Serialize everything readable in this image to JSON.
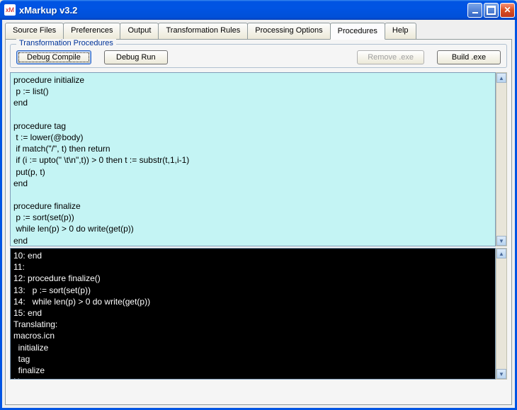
{
  "window": {
    "title": "xMarkup v3.2",
    "app_icon_text": "xM"
  },
  "tabs": [
    {
      "label": "Source Files",
      "active": false
    },
    {
      "label": "Preferences",
      "active": false
    },
    {
      "label": "Output",
      "active": false
    },
    {
      "label": "Transformation Rules",
      "active": false
    },
    {
      "label": "Processing Options",
      "active": false
    },
    {
      "label": "Procedures",
      "active": true
    },
    {
      "label": "Help",
      "active": false
    }
  ],
  "fieldset": {
    "legend": "Transformation Procedures",
    "buttons": {
      "debug_compile": "Debug Compile",
      "debug_run": "Debug Run",
      "remove_exe": "Remove .exe",
      "build_exe": "Build .exe"
    }
  },
  "editor_text": "procedure initialize\n p := list()\nend\n\nprocedure tag\n t := lower(@body)\n if match(\"/\", t) then return\n if (i := upto(\" \\t\\n\",t)) > 0 then t := substr(t,1,i-1)\n put(p, t)\nend\n\nprocedure finalize\n p := sort(set(p))\n while len(p) > 0 do write(get(p))\nend",
  "output_text": "10: end\n11:\n12: procedure finalize()\n13:   p := sort(set(p))\n14:   while len(p) > 0 do write(get(p))\n15: end\nTranslating:\nmacros.icn\n  initialize\n  tag\n  finalize\nNo errors"
}
